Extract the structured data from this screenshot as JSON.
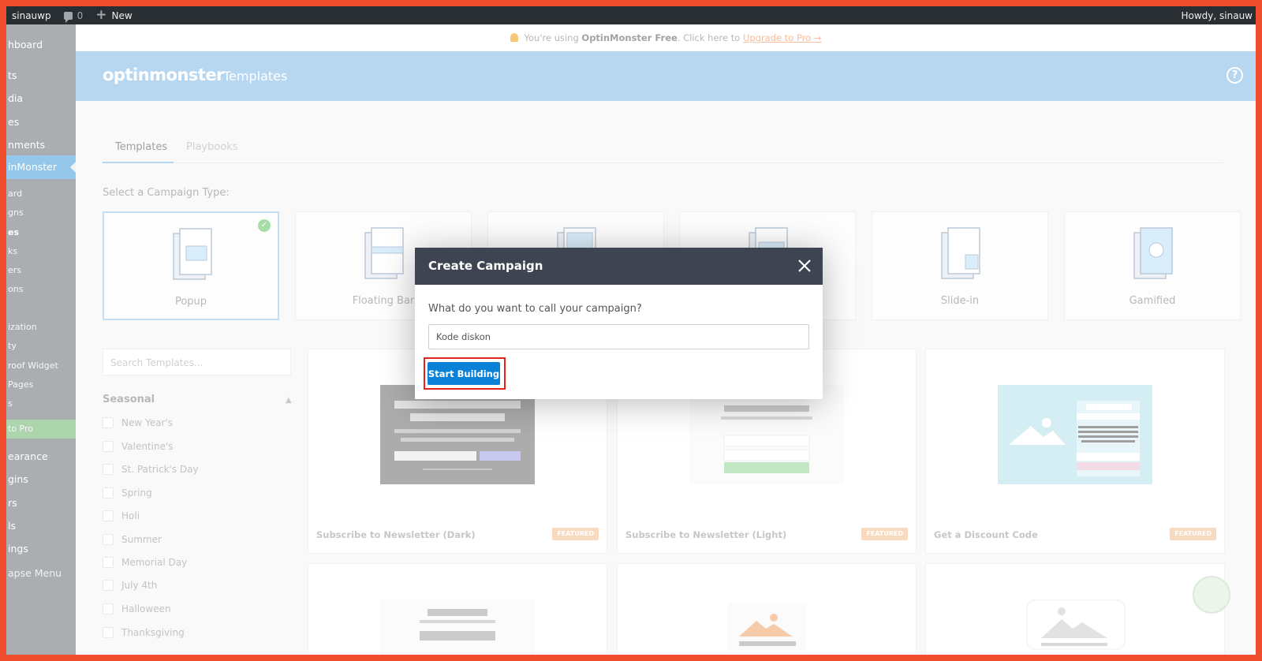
{
  "admin_bar": {
    "site": "sinauwp",
    "comments": "0",
    "new": "New",
    "howdy": "Howdy, sinauw"
  },
  "sidebar": {
    "items": [
      {
        "label": "hboard"
      },
      {
        "label": "ts"
      },
      {
        "label": "dia"
      },
      {
        "label": "es"
      },
      {
        "label": "nments"
      },
      {
        "label": "inMonster"
      },
      {
        "label": "ard"
      },
      {
        "label": "gns"
      },
      {
        "label": "es"
      },
      {
        "label": "ks"
      },
      {
        "label": "ers"
      },
      {
        "label": "ons"
      },
      {
        "label": "ization"
      },
      {
        "label": "ty"
      },
      {
        "label": "roof Widget"
      },
      {
        "label": "Pages"
      },
      {
        "label": "s"
      },
      {
        "label": "to Pro"
      },
      {
        "label": "earance"
      },
      {
        "label": "gins"
      },
      {
        "label": "rs"
      },
      {
        "label": "ls"
      },
      {
        "label": "ings"
      },
      {
        "label": "apse Menu"
      }
    ]
  },
  "notice": {
    "pre": "You're using ",
    "bold": "OptinMonster Free",
    "mid": ". Click here to ",
    "link": "Upgrade to Pro →"
  },
  "header": {
    "logo": "optinmonster",
    "section": "Templates",
    "help": "?"
  },
  "tabs": [
    {
      "label": "Templates"
    },
    {
      "label": "Playbooks"
    }
  ],
  "campaign_type_label": "Select a Campaign Type:",
  "campaign_types": [
    {
      "label": "Popup"
    },
    {
      "label": "Floating Bar"
    },
    {
      "label": ""
    },
    {
      "label": ""
    },
    {
      "label": "Slide-in"
    },
    {
      "label": "Gamified"
    }
  ],
  "search": {
    "placeholder": "Search Templates..."
  },
  "filters": {
    "title": "Seasonal",
    "items": [
      "New Year's",
      "Valentine's",
      "St. Patrick's Day",
      "Spring",
      "Holi",
      "Summer",
      "Memorial Day",
      "July 4th",
      "Halloween",
      "Thanksgiving"
    ]
  },
  "templates": [
    {
      "name": "Subscribe to Newsletter (Dark)",
      "badge": "FEATURED"
    },
    {
      "name": "Subscribe to Newsletter (Light)",
      "badge": "FEATURED"
    },
    {
      "name": "Get a Discount Code",
      "badge": "FEATURED"
    }
  ],
  "modal": {
    "title": "Create Campaign",
    "question": "What do you want to call your campaign?",
    "input_value": "Kode diskon",
    "button": "Start Building"
  },
  "colors": {
    "accent": "#0b80d7",
    "header": "#b4d5f1",
    "modal_head": "#3e4451",
    "highlight": "#e2231a"
  }
}
